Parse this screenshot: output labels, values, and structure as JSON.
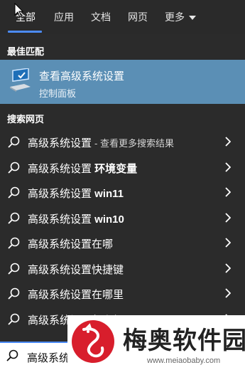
{
  "tabs": [
    {
      "label": "全部",
      "active": true
    },
    {
      "label": "应用",
      "active": false
    },
    {
      "label": "文档",
      "active": false
    },
    {
      "label": "网页",
      "active": false
    },
    {
      "label": "更多",
      "active": false
    }
  ],
  "best_match": {
    "section_label": "最佳匹配",
    "title": "查看高级系统设置",
    "subtitle": "控制面板",
    "icon": "laptop-settings-icon"
  },
  "web_search": {
    "section_label": "搜索网页",
    "items": [
      {
        "text": "高级系统设置",
        "suffix": "- 查看更多搜索结果"
      },
      {
        "text": "高级系统设置 ",
        "bold": "环境变量"
      },
      {
        "text": "高级系统设置 ",
        "bold": "win11"
      },
      {
        "text": "高级系统设置 ",
        "bold": "win10"
      },
      {
        "text": "高级系统设置在哪"
      },
      {
        "text": "高级系统设置快捷键"
      },
      {
        "text": "高级系统设置在哪里"
      },
      {
        "text": "高级系统设置怎么打开"
      }
    ]
  },
  "search_box": {
    "value": "高级系统"
  },
  "watermark": {
    "title": "梅奥软件园",
    "url": "www.meiaobaby.com"
  },
  "colors": {
    "background": "#2b2b2b",
    "highlight": "#5b8fb5",
    "accent": "#4c8bf5"
  }
}
